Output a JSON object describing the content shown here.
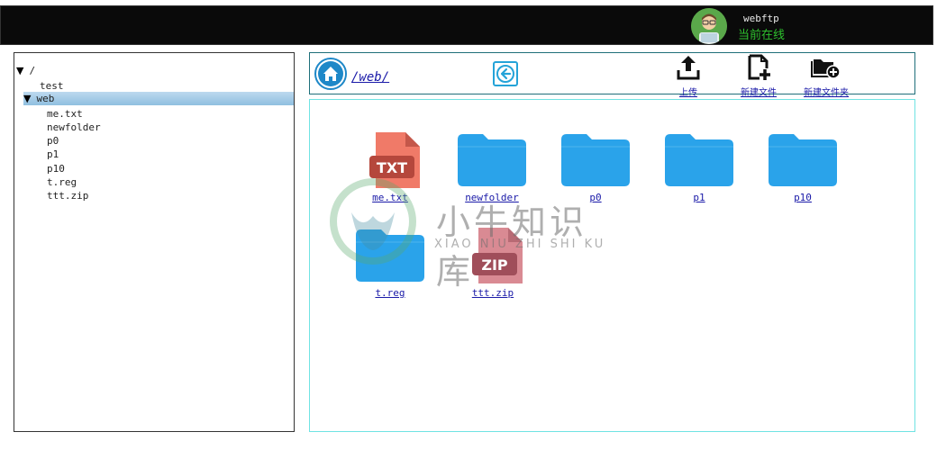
{
  "header": {
    "username": "webftp",
    "status": "当前在线"
  },
  "tree": {
    "root_label": "/",
    "items": [
      {
        "label": "test",
        "depth": 1
      },
      {
        "label": "web",
        "depth": 1,
        "expanded": true,
        "selected": true
      },
      {
        "label": "me.txt",
        "depth": 2
      },
      {
        "label": "newfolder",
        "depth": 2
      },
      {
        "label": "p0",
        "depth": 2
      },
      {
        "label": "p1",
        "depth": 2
      },
      {
        "label": "p10",
        "depth": 2
      },
      {
        "label": "t.reg",
        "depth": 2
      },
      {
        "label": "ttt.zip",
        "depth": 2
      }
    ]
  },
  "toolbar": {
    "path": "/web/",
    "upload_label": "上传",
    "new_file_label": "新建文件",
    "new_folder_label": "新建文件夹"
  },
  "files": [
    {
      "name": "me.txt",
      "type": "txt",
      "badge": "TXT"
    },
    {
      "name": "newfolder",
      "type": "folder"
    },
    {
      "name": "p0",
      "type": "folder"
    },
    {
      "name": "p1",
      "type": "folder"
    },
    {
      "name": "p10",
      "type": "folder"
    },
    {
      "name": "t.reg",
      "type": "folder"
    },
    {
      "name": "ttt.zip",
      "type": "zip",
      "badge": "ZIP"
    }
  ],
  "watermark": {
    "title": "小牛知识库",
    "subtitle": "XIAO NIU ZHI SHI KU"
  },
  "colors": {
    "folder": "#2aa3ea",
    "txt_file": "#f07a68",
    "txt_badge": "#b5473c",
    "zip_file": "#d98a93",
    "zip_badge": "#a04e5a",
    "online": "#2ec02e",
    "tree_selected": "#9ec8e6"
  }
}
